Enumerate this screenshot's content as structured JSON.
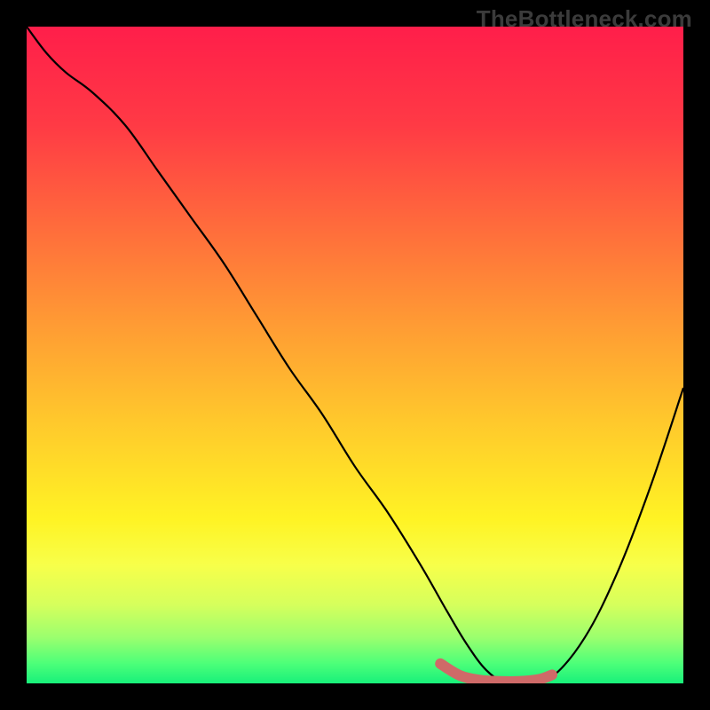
{
  "watermark": "TheBottleneck.com",
  "colors": {
    "background": "#000000",
    "gradient_stops": [
      {
        "offset": 0.0,
        "color": "#ff1e4a"
      },
      {
        "offset": 0.15,
        "color": "#ff3a45"
      },
      {
        "offset": 0.3,
        "color": "#ff6a3c"
      },
      {
        "offset": 0.45,
        "color": "#ff9a34"
      },
      {
        "offset": 0.6,
        "color": "#ffc82c"
      },
      {
        "offset": 0.75,
        "color": "#fff324"
      },
      {
        "offset": 0.82,
        "color": "#f7ff4a"
      },
      {
        "offset": 0.88,
        "color": "#d6ff5c"
      },
      {
        "offset": 0.93,
        "color": "#9bff6e"
      },
      {
        "offset": 0.97,
        "color": "#4cff79"
      },
      {
        "offset": 1.0,
        "color": "#18f07a"
      }
    ],
    "curve": "#000000",
    "marker": "#cf6a68"
  },
  "chart_data": {
    "type": "line",
    "title": "",
    "xlabel": "",
    "ylabel": "",
    "xlim": [
      0,
      100
    ],
    "ylim": [
      0,
      100
    ],
    "grid": false,
    "legend": false,
    "series": [
      {
        "name": "bottleneck-curve",
        "x": [
          0,
          3,
          6,
          10,
          15,
          20,
          25,
          30,
          35,
          40,
          45,
          50,
          55,
          60,
          64,
          67,
          70,
          73,
          76,
          80,
          85,
          90,
          95,
          100
        ],
        "y": [
          100,
          96,
          93,
          90,
          85,
          78,
          71,
          64,
          56,
          48,
          41,
          33,
          26,
          18,
          11,
          6,
          2,
          0,
          0,
          1,
          7,
          17,
          30,
          45
        ]
      }
    ],
    "marker_segment": {
      "x": [
        63,
        66,
        69,
        72,
        75,
        78,
        80
      ],
      "y": [
        3,
        1.2,
        0.5,
        0.3,
        0.3,
        0.6,
        1.3
      ]
    }
  }
}
